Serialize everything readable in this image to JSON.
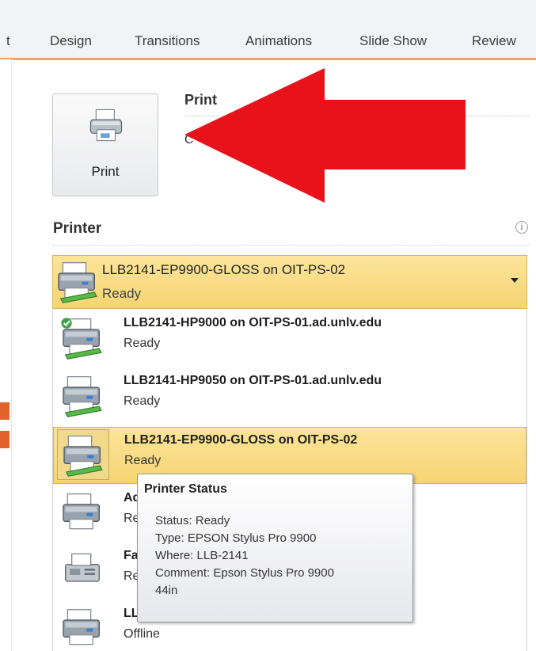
{
  "ribbon": {
    "tabs": [
      {
        "label": "t"
      },
      {
        "label": "Design"
      },
      {
        "label": "Transitions"
      },
      {
        "label": "Animations"
      },
      {
        "label": "Slide Show"
      },
      {
        "label": "Review"
      }
    ]
  },
  "print_section": {
    "button_label": "Print",
    "heading": "Print",
    "copies_fragment": "C"
  },
  "printer_section": {
    "heading": "Printer",
    "info_glyph": "i",
    "selected": {
      "name": "LLB2141-EP9900-GLOSS on OIT-PS-02",
      "status": "Ready"
    },
    "list": [
      {
        "name": "LLB2141-HP9000 on OIT-PS-01.ad.unlv.edu",
        "status": "Ready",
        "icon": "network-printer-default-icon"
      },
      {
        "name": "LLB2141-HP9050 on OIT-PS-01.ad.unlv.edu",
        "status": "Ready",
        "icon": "network-printer-icon"
      },
      {
        "name": "LLB2141-EP9900-GLOSS on OIT-PS-02",
        "status": "Ready",
        "icon": "network-printer-icon"
      },
      {
        "name": "Ad",
        "status": "Re",
        "icon": "printer-icon"
      },
      {
        "name": "Fa",
        "status": "Re",
        "icon": "fax-icon"
      },
      {
        "name": "LL",
        "status": "Offline",
        "icon": "printer-icon"
      }
    ]
  },
  "tooltip": {
    "title": "Printer Status",
    "status": "Status: Ready",
    "type": "Type: EPSON Stylus Pro 9900",
    "where": "Where: LLB-2141",
    "comment": "Comment: Epson Stylus Pro 9900",
    "comment_cont": "44in"
  },
  "colors": {
    "highlight": "#f6d472",
    "arrow": "#e8121b",
    "ribbon_edge": "#e8a56e"
  }
}
